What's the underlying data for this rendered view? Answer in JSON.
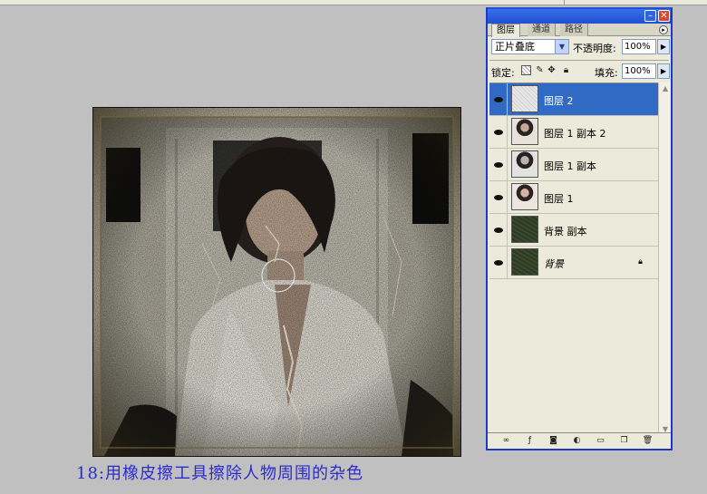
{
  "caption": "18:用橡皮擦工具擦除人物周围的杂色",
  "panel": {
    "tabs": [
      "图层",
      "通道",
      "路径"
    ],
    "blend_mode": "正片叠底",
    "opacity_label": "不透明度:",
    "opacity_value": "100%",
    "lock_label": "锁定:",
    "fill_label": "填充:",
    "fill_value": "100%",
    "layers": [
      {
        "name": "图层 2",
        "selected": true,
        "thumb": "noise"
      },
      {
        "name": "图层 1 副本 2",
        "selected": false,
        "thumb": "portrait"
      },
      {
        "name": "图层 1 副本",
        "selected": false,
        "thumb": "portrait"
      },
      {
        "name": "图层 1",
        "selected": false,
        "thumb": "portrait"
      },
      {
        "name": "背景 副本",
        "selected": false,
        "thumb": "green"
      },
      {
        "name": "背景",
        "selected": false,
        "thumb": "green",
        "locked": true
      }
    ]
  },
  "colors": {
    "selection": "#316ac5",
    "caption": "#2b2bd0",
    "titlebar": "#1f4fd4",
    "background": "#c0c0c0"
  }
}
